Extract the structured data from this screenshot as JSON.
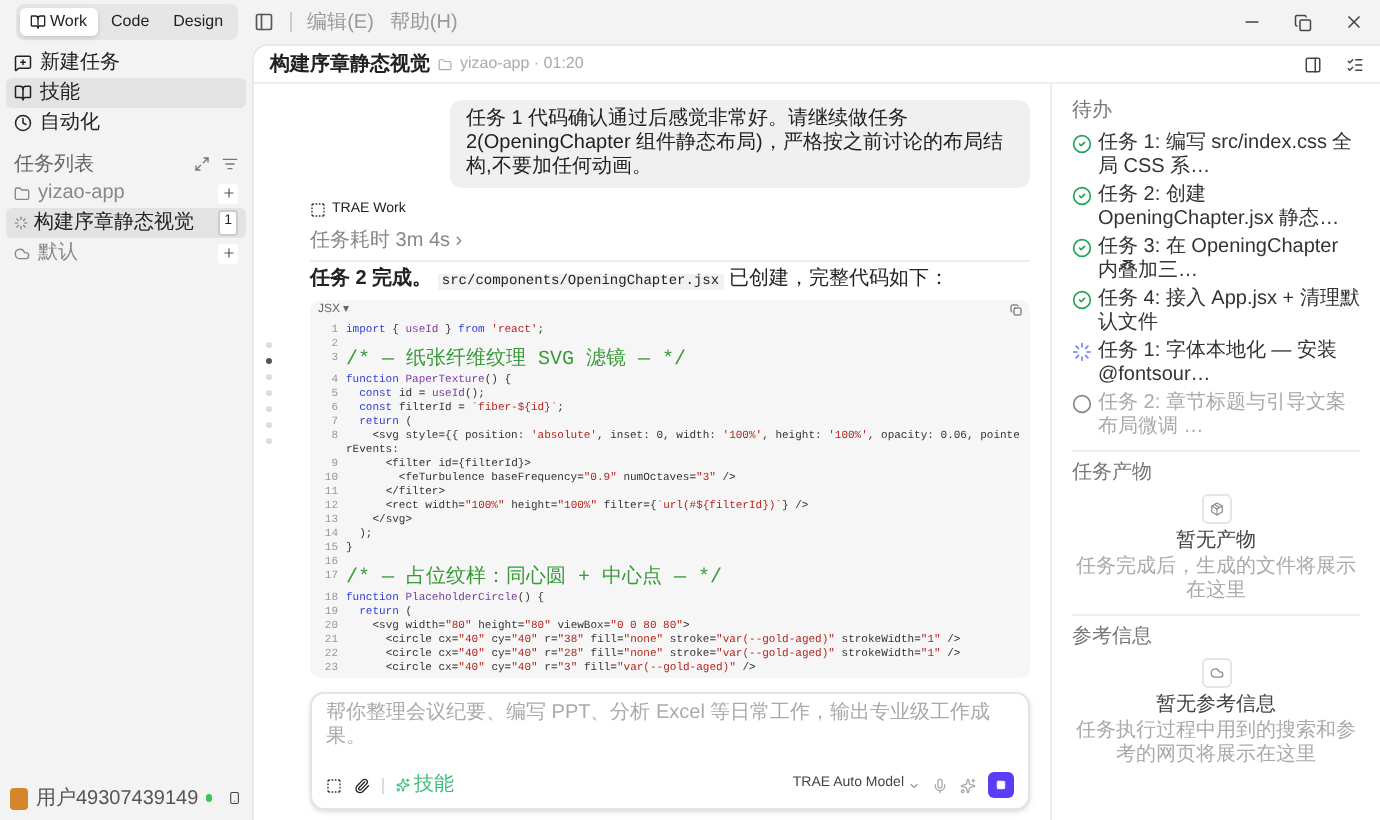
{
  "titlebar": {
    "modes": [
      {
        "label": "Work",
        "selected": true
      },
      {
        "label": "Code",
        "selected": false
      },
      {
        "label": "Design",
        "selected": false
      }
    ],
    "menus": [
      "编辑(E)",
      "帮助(H)"
    ]
  },
  "sidebar": {
    "nav": [
      {
        "label": "新建任务",
        "kind": "new",
        "selected": false
      },
      {
        "label": "技能",
        "kind": "skills",
        "selected": true
      },
      {
        "label": "自动化",
        "kind": "automation",
        "selected": false
      }
    ],
    "section_title": "任务列表",
    "groups": [
      {
        "label": "yizao-app",
        "kind": "folder",
        "children": [
          {
            "label": "构建序章静态视觉",
            "badge": "1",
            "selected": true
          }
        ]
      },
      {
        "label": "默认",
        "kind": "cloud"
      }
    ],
    "user": {
      "name": "用户49307439149",
      "online": true
    }
  },
  "header": {
    "title": "构建序章静态视觉",
    "project": "yizao-app · 01:20"
  },
  "chat": {
    "user_message": "任务 1 代码确认通过后感觉非常好。请继续做任务 2(OpeningChapter 组件静态布局)，严格按之前讨论的布局结构,不要加任何动画。",
    "agent": "TRAE Work",
    "duration": "任务耗时 3m 4s ›",
    "intro": "**任务 2 完成。**",
    "file": "src/components/OpeningChapter.jsx",
    "outro": "已创建，完整代码如下：",
    "code": {
      "language": "JSX ▾",
      "lines": [
        {
          "number": "1",
          "text": "import { useId } from 'react';"
        },
        {
          "number": "2"
        },
        {
          "number": "3",
          "text": "/* — 纸张纤维纹理 SVG 滤镜 — */"
        },
        {
          "number": "4",
          "text": "function PaperTexture() {"
        },
        {
          "number": "5",
          "text": "  const id = useId();"
        },
        {
          "number": "6",
          "text": "  const filterId = `fiber-${id}`;"
        },
        {
          "number": "7",
          "text": "  return ("
        },
        {
          "number": "8",
          "text": "    <svg style={{ position: 'absolute', inset: 0, width: '100%', height: '100%', opacity: 0.06, pointerEvents:"
        },
        {
          "number": "9",
          "text": "      <filter id={filterId}>"
        },
        {
          "number": "10",
          "text": "        <feTurbulence baseFrequency=\"0.9\" numOctaves=\"3\" />"
        },
        {
          "number": "11",
          "text": "      </filter>"
        },
        {
          "number": "12",
          "text": "      <rect width=\"100%\" height=\"100%\" filter={`url(#${filterId})`} />"
        },
        {
          "number": "13",
          "text": "    </svg>"
        },
        {
          "number": "14",
          "text": "  );"
        },
        {
          "number": "15",
          "text": "}"
        },
        {
          "number": "16"
        },
        {
          "number": "17",
          "text": "/* — 占位纹样：同心圆 + 中心点 — */"
        },
        {
          "number": "18",
          "text": "function PlaceholderCircle() {"
        },
        {
          "number": "19",
          "text": "  return ("
        },
        {
          "number": "20",
          "text": "    <svg width=\"80\" height=\"80\" viewBox=\"0 0 80 80\">"
        },
        {
          "number": "21",
          "text": "      <circle cx=\"40\" cy=\"40\" r=\"38\" fill=\"none\" stroke=\"var(--gold-aged)\" strokeWidth=\"1\" />"
        },
        {
          "number": "22",
          "text": "      <circle cx=\"40\" cy=\"40\" r=\"28\" fill=\"none\" stroke=\"var(--gold-aged)\" strokeWidth=\"1\" />"
        },
        {
          "number": "23",
          "text": "      <circle cx=\"40\" cy=\"40\" r=\"3\" fill=\"var(--gold-aged)\" />"
        }
      ]
    }
  },
  "composer": {
    "placeholder": "帮你整理会议纪要、编写 PPT、分析 Excel 等日常工作，输出专业级工作成果。",
    "skill": "技能",
    "model": "TRAE Auto Model"
  },
  "panel": {
    "todo_title": "待办",
    "todos": [
      {
        "text": "任务 1: 编写 src/index.css 全局 CSS 系…",
        "kind": "done"
      },
      {
        "text": "任务 2: 创建 OpeningChapter.jsx 静态…",
        "kind": "done"
      },
      {
        "text": "任务 3: 在 OpeningChapter 内叠加三…",
        "kind": "done"
      },
      {
        "text": "任务 4: 接入 App.jsx + 清理默认文件",
        "kind": "done"
      },
      {
        "text": "任务 1: 字体本地化 — 安装 @fontsour…",
        "kind": "running"
      },
      {
        "text": "任务 2: 章节标题与引导文案布局微调 …",
        "kind": "pending"
      }
    ],
    "sections": [
      {
        "title": "任务产物",
        "kind": "artifacts",
        "empty_title": "暂无产物",
        "empty_text": "任务完成后，生成的文件将展示在这里"
      },
      {
        "title": "参考信息",
        "kind": "references",
        "empty_title": "暂无参考信息",
        "empty_text": "任务执行过程中用到的搜索和参考的网页将展示在这里"
      }
    ]
  }
}
